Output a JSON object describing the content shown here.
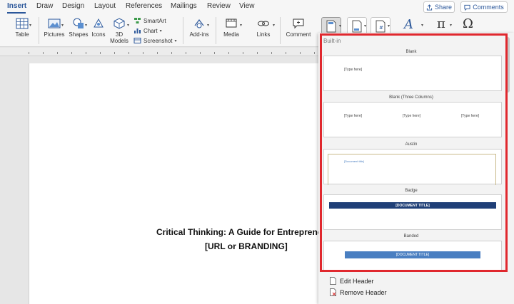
{
  "tabs": [
    "Insert",
    "Draw",
    "Design",
    "Layout",
    "References",
    "Mailings",
    "Review",
    "View"
  ],
  "active_tab": "Insert",
  "share_label": "Share",
  "comments_label": "Comments",
  "ribbon": {
    "table": "Table",
    "pictures": "Pictures",
    "shapes": "Shapes",
    "icons": "Icons",
    "models_line1": "3D",
    "models_line2": "Models",
    "smartart": "SmartArt",
    "chart": "Chart",
    "screenshot": "Screenshot",
    "addins": "Add-ins",
    "media": "Media",
    "links": "Links",
    "comment": "Comment"
  },
  "document": {
    "line1": "Critical Thinking: A Guide for Entreprene",
    "line2": "[URL or BRANDING]"
  },
  "gallery": {
    "section_label": "Built-in",
    "items": [
      {
        "title": "Blank",
        "placeholder": "[Type here]"
      },
      {
        "title": "Blank (Three Columns)",
        "placeholders": [
          "[Type here]",
          "[Type here]",
          "[Type here]"
        ]
      },
      {
        "title": "Austin",
        "placeholder": "[Document title]"
      },
      {
        "title": "Badge",
        "placeholder": "[DOCUMENT TITLE]"
      },
      {
        "title": "Banded",
        "placeholder": "[DOCUMENT TITLE]"
      }
    ],
    "edit_header": "Edit Header",
    "remove_header": "Remove Header"
  },
  "colors": {
    "accent": "#2b579a",
    "highlight_border": "#e0282e",
    "badge_bar": "#1f3f77",
    "banded_bar": "#4a7fc1"
  }
}
